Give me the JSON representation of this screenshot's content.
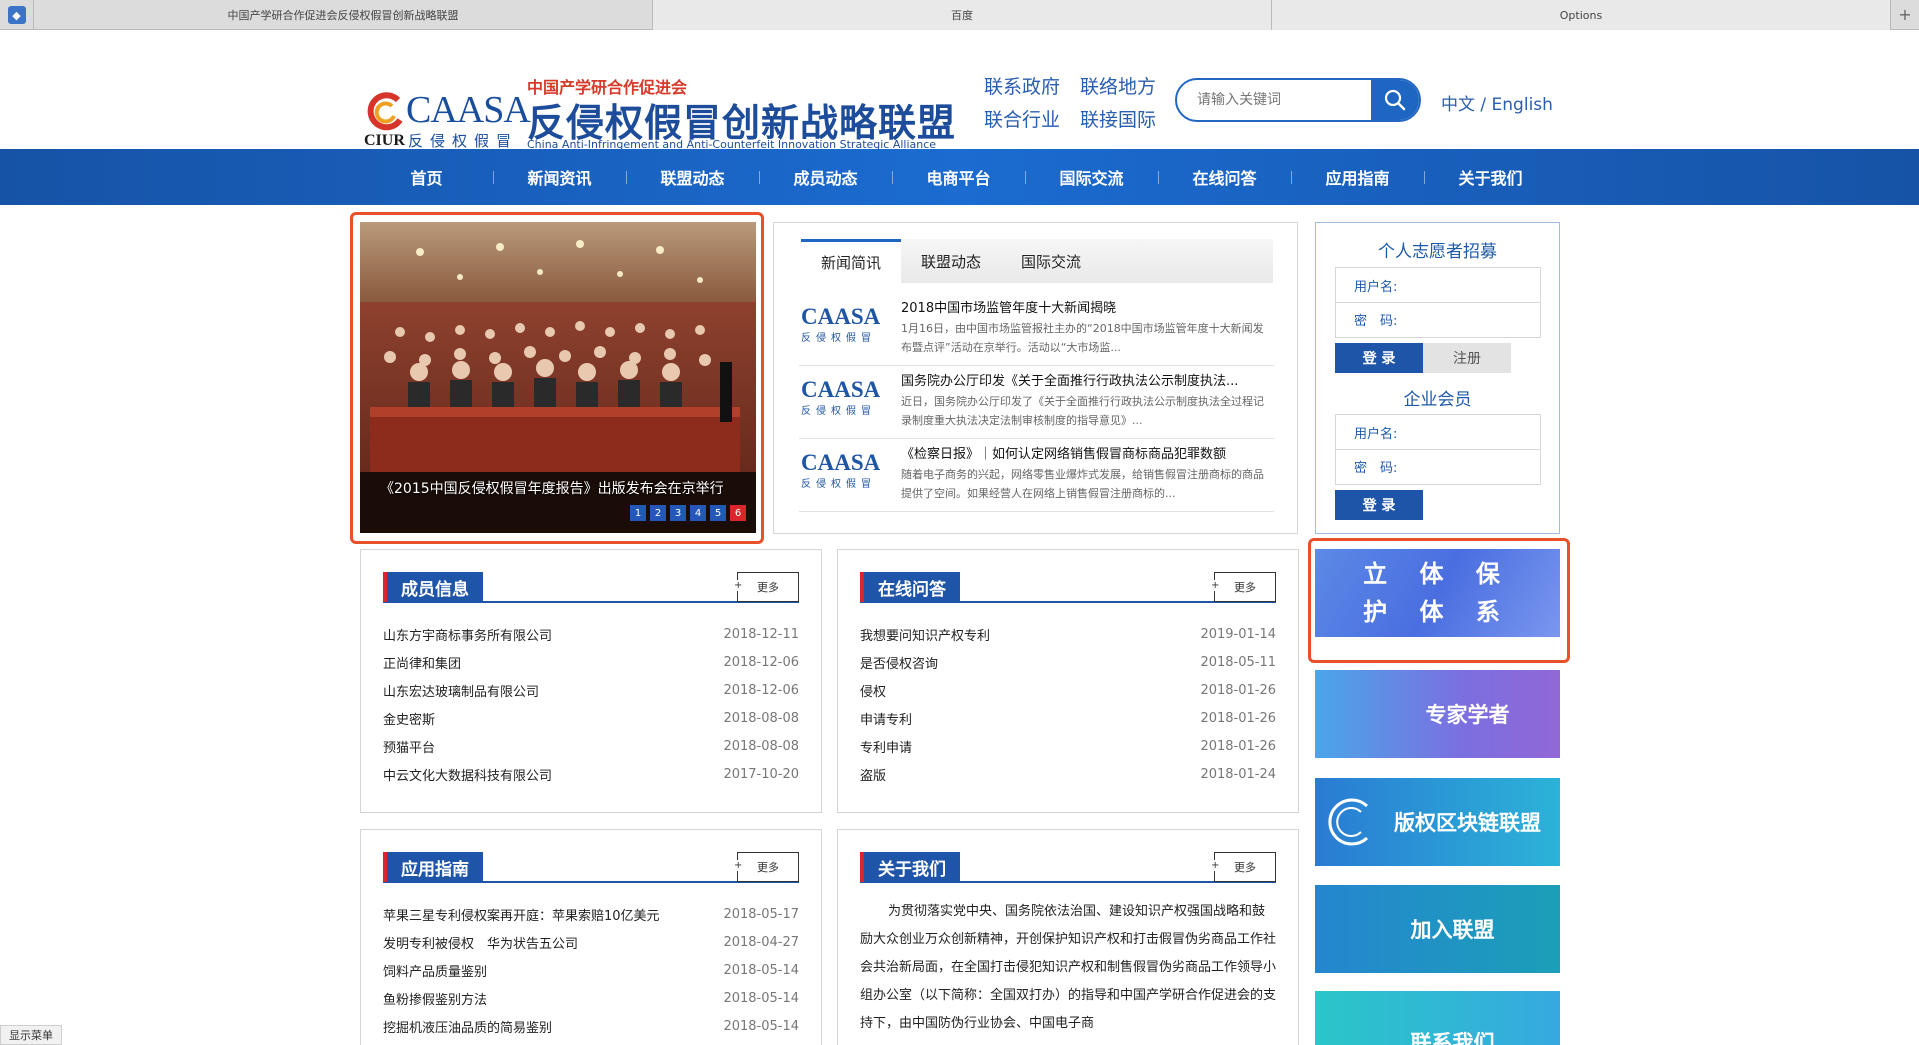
{
  "browser": {
    "tabs": [
      {
        "label": "中国产学研合作促进会反侵权假冒创新战略联盟",
        "active": false
      },
      {
        "label": "百度",
        "active": true
      },
      {
        "label": "Options",
        "active": true
      }
    ],
    "new_tab": "+"
  },
  "header": {
    "logo": {
      "caasa": "CAASA",
      "ciur": "CIUR",
      "ciur_cn": "反侵权假冒",
      "org": "中国产学研合作促进会",
      "name": "反侵权假冒创新战略联盟",
      "en": "China Anti-Infringement and Anti-Counterfeit Innovation Strategic Alliance"
    },
    "slogans": [
      "联系政府",
      "联络地方",
      "联合行业",
      "联接国际"
    ],
    "search_placeholder": "请输入关键词",
    "lang": "中文 / English"
  },
  "nav": [
    "首页",
    "新闻资讯",
    "联盟动态",
    "成员动态",
    "电商平台",
    "国际交流",
    "在线问答",
    "应用指南",
    "关于我们"
  ],
  "slider": {
    "caption": "《2015中国反侵权假冒年度报告》出版发布会在京举行",
    "pages": [
      "1",
      "2",
      "3",
      "4",
      "5",
      "6"
    ],
    "active_page": 6
  },
  "news": {
    "tabs": [
      "新闻简讯",
      "联盟动态",
      "国际交流"
    ],
    "logo_text": "CAASA",
    "logo_sub": "反侵权假冒",
    "items": [
      {
        "title": "2018中国市场监管年度十大新闻揭晓",
        "desc": "1月16日，由中国市场监管报社主办的“2018中国市场监管年度十大新闻发布暨点评”活动在京举行。活动以“大市场监..."
      },
      {
        "title": "国务院办公厅印发《关于全面推行行政执法公示制度执法...",
        "desc": "近日，国务院办公厅印发了《关于全面推行行政执法公示制度执法全过程记录制度重大执法决定法制审核制度的指导意见》..."
      },
      {
        "title": "《检察日报》｜如何认定网络销售假冒商标商品犯罪数额",
        "desc": "随着电子商务的兴起，网络零售业爆炸式发展，给销售假冒注册商标的商品提供了空间。如果经营人在网络上销售假冒注册商标的..."
      }
    ]
  },
  "login": {
    "volunteer_title": "个人志愿者招募",
    "company_title": "企业会员",
    "username_label": "用户名:",
    "password_label": "密　码:",
    "login_btn": "登 录",
    "register_btn": "注册"
  },
  "banners": [
    "立 体 保 护 体 系",
    "专家学者",
    "版权区块链联盟",
    "加入联盟",
    "联系我们"
  ],
  "members": {
    "title": "成员信息",
    "more": "更多",
    "rows": [
      {
        "name": "山东方宇商标事务所有限公司",
        "date": "2018-12-11"
      },
      {
        "name": "正尚律和集团",
        "date": "2018-12-06"
      },
      {
        "name": "山东宏达玻璃制品有限公司",
        "date": "2018-12-06"
      },
      {
        "name": "金史密斯",
        "date": "2018-08-08"
      },
      {
        "name": "预猫平台",
        "date": "2018-08-08"
      },
      {
        "name": "中云文化大数据科技有限公司",
        "date": "2017-10-20"
      }
    ]
  },
  "qa": {
    "title": "在线问答",
    "more": "更多",
    "rows": [
      {
        "name": "我想要问知识产权专利",
        "date": "2019-01-14"
      },
      {
        "name": "是否侵权咨询",
        "date": "2018-05-11"
      },
      {
        "name": "侵权",
        "date": "2018-01-26"
      },
      {
        "name": "申请专利",
        "date": "2018-01-26"
      },
      {
        "name": "专利申请",
        "date": "2018-01-26"
      },
      {
        "name": "盗版",
        "date": "2018-01-24"
      }
    ]
  },
  "guide": {
    "title": "应用指南",
    "more": "更多",
    "rows": [
      {
        "name": "苹果三星专利侵权案再开庭：苹果索赔10亿美元",
        "date": "2018-05-17"
      },
      {
        "name": "发明专利被侵权　华为状告五公司",
        "date": "2018-04-27"
      },
      {
        "name": "饲料产品质量鉴别",
        "date": "2018-05-14"
      },
      {
        "name": "鱼粉掺假鉴别方法",
        "date": "2018-05-14"
      },
      {
        "name": "挖掘机液压油品质的简易鉴别",
        "date": "2018-05-14"
      }
    ]
  },
  "about": {
    "title": "关于我们",
    "more": "更多",
    "text": "为贯彻落实党中央、国务院依法治国、建设知识产权强国战略和鼓励大众创业万众创新精神，开创保护知识产权和打击假冒伪劣商品工作社会共治新局面，在全国打击侵犯知识产权和制售假冒伪劣商品工作领导小组办公室（以下简称：全国双打办）的指导和中国产学研合作促进会的支持下，由中国防伪行业协会、中国电子商"
  },
  "status_bar": "显示菜单",
  "colors": {
    "primary": "#1f55a8",
    "nav": "#1b6bd0",
    "accent_red": "#d9262a",
    "highlight": "#e8502a"
  }
}
